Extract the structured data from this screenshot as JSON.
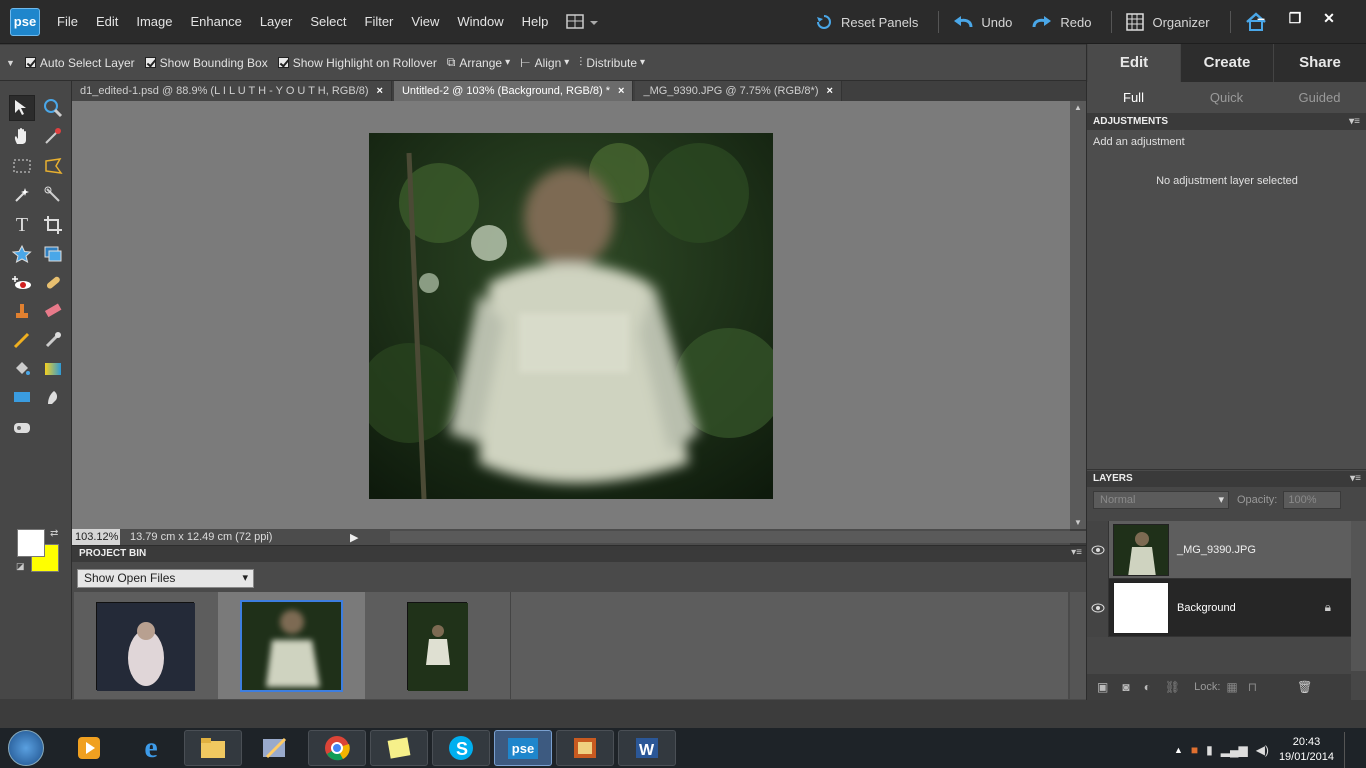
{
  "app": {
    "logo": "pse"
  },
  "menu": [
    "File",
    "Edit",
    "Image",
    "Enhance",
    "Layer",
    "Select",
    "Filter",
    "View",
    "Window",
    "Help"
  ],
  "top_actions": {
    "reset_panels": "Reset Panels",
    "undo": "Undo",
    "redo": "Redo",
    "organizer": "Organizer"
  },
  "options": {
    "auto_select": "Auto Select Layer",
    "bounding_box": "Show Bounding Box",
    "highlight": "Show Highlight on Rollover",
    "arrange": "Arrange",
    "align": "Align",
    "distribute": "Distribute"
  },
  "tabs": [
    {
      "label": "d1_edited-1.psd @ 88.9% (L I L U T H - Y O U T H, RGB/8)"
    },
    {
      "label": "Untitled-2 @ 103% (Background, RGB/8) *"
    },
    {
      "label": "_MG_9390.JPG @ 7.75% (RGB/8*)"
    }
  ],
  "status": {
    "zoom": "103.12%",
    "doc_size": "13.79 cm x 12.49 cm (72 ppi)"
  },
  "project_bin": {
    "title": "PROJECT BIN",
    "filter": "Show Open Files"
  },
  "right_panel": {
    "modes": [
      "Edit",
      "Create",
      "Share"
    ],
    "submodes": [
      "Full",
      "Quick",
      "Guided"
    ],
    "adjustments": {
      "title": "ADJUSTMENTS",
      "add": "Add an adjustment",
      "none": "No adjustment layer selected"
    },
    "layers": {
      "title": "LAYERS",
      "blend": "Normal",
      "opacity_label": "Opacity:",
      "opacity_value": "100%",
      "lock_label": "Lock:",
      "items": [
        {
          "name": "_MG_9390.JPG"
        },
        {
          "name": "Background"
        }
      ]
    }
  },
  "taskbar": {
    "time": "20:43",
    "date": "19/01/2014"
  },
  "colors": {
    "foreground": "#ffffff",
    "background": "#ffff00"
  }
}
